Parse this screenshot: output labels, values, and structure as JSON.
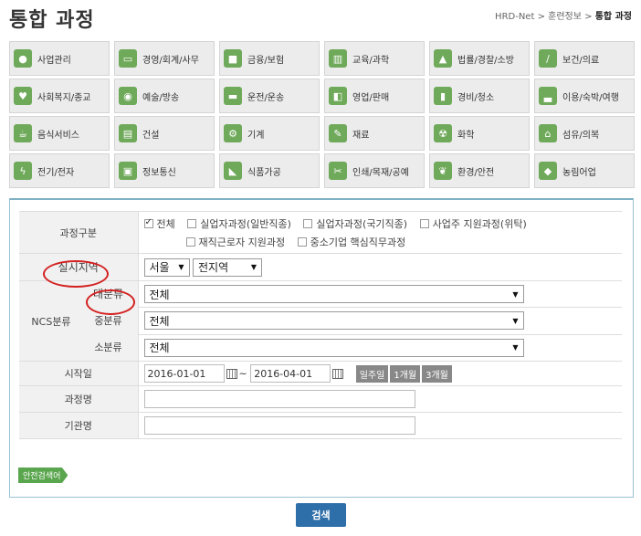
{
  "title": "통합 과정",
  "breadcrumb": [
    "HRD-Net",
    "훈련정보",
    "통합 과정"
  ],
  "categories": [
    {
      "label": "사업관리",
      "icon": "person-icon"
    },
    {
      "label": "경영/회계/사무",
      "icon": "monitor-icon"
    },
    {
      "label": "금융/보험",
      "icon": "safe-icon"
    },
    {
      "label": "교육/과학",
      "icon": "books-icon"
    },
    {
      "label": "법률/경찰/소방",
      "icon": "gavel-icon"
    },
    {
      "label": "보건/의료",
      "icon": "syringe-icon"
    },
    {
      "label": "사회복지/종교",
      "icon": "heart-icon"
    },
    {
      "label": "예술/방송",
      "icon": "camera-icon"
    },
    {
      "label": "운전/운송",
      "icon": "car-icon"
    },
    {
      "label": "영업/판매",
      "icon": "sales-icon"
    },
    {
      "label": "경비/청소",
      "icon": "guard-icon"
    },
    {
      "label": "이용/숙박/여행",
      "icon": "bed-icon"
    },
    {
      "label": "음식서비스",
      "icon": "cup-icon"
    },
    {
      "label": "건설",
      "icon": "clipboard-icon"
    },
    {
      "label": "기계",
      "icon": "gear-icon"
    },
    {
      "label": "재료",
      "icon": "tool-icon"
    },
    {
      "label": "화학",
      "icon": "radiation-icon"
    },
    {
      "label": "섬유/의복",
      "icon": "building-icon"
    },
    {
      "label": "전기/전자",
      "icon": "lightning-icon"
    },
    {
      "label": "정보통신",
      "icon": "computer-icon"
    },
    {
      "label": "식품가공",
      "icon": "food-icon"
    },
    {
      "label": "인쇄/목재/공예",
      "icon": "print-icon"
    },
    {
      "label": "환경/안전",
      "icon": "leaf-icon"
    },
    {
      "label": "농림어업",
      "icon": "fish-icon"
    }
  ],
  "form": {
    "course_type": {
      "label": "과정구분",
      "options": [
        {
          "label": "전체",
          "checked": true
        },
        {
          "label": "실업자과정(일반직종)",
          "checked": false
        },
        {
          "label": "실업자과정(국기직종)",
          "checked": false
        },
        {
          "label": "사업주 지원과정(위탁)",
          "checked": false
        },
        {
          "label": "재직근로자 지원과정",
          "checked": false
        },
        {
          "label": "중소기업 핵심직무과정",
          "checked": false
        }
      ]
    },
    "region": {
      "label": "실시지역",
      "city": "서울",
      "district": "전지역"
    },
    "ncs": {
      "label": "NCS분류",
      "major_label": "대분류",
      "major_value": "전체",
      "middle_label": "중분류",
      "middle_value": "전체",
      "minor_label": "소분류",
      "minor_value": "전체"
    },
    "start_date": {
      "label": "시작일",
      "from": "2016-01-01",
      "tilde": "~",
      "to": "2016-04-01",
      "quick": [
        "일주일",
        "1개월",
        "3개월"
      ]
    },
    "course_name": {
      "label": "과정명",
      "value": ""
    },
    "institution": {
      "label": "기관명",
      "value": ""
    }
  },
  "advanced_search_label": "안전검색어",
  "search_button_label": "검색",
  "colors": {
    "accent": "#2f6fa9",
    "category_icon": "#6fa95a",
    "annotation": "#d42020"
  }
}
